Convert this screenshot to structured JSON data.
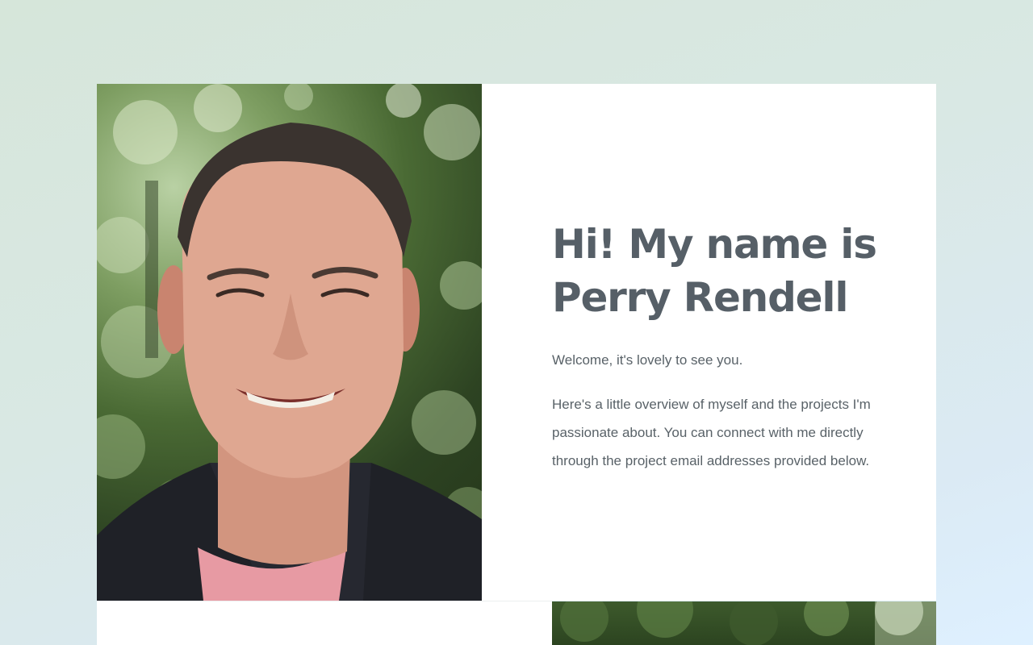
{
  "hero": {
    "title_line1": "Hi! My name is",
    "title_line2": "Perry Rendell",
    "welcome": "Welcome, it's lovely to see you.",
    "overview": "Here's a little overview of myself and the projects I'm passionate about. You can connect with me directly through the project email addresses provided below.",
    "portrait_alt": "Perry Rendell"
  },
  "colors": {
    "heading": "#565f67",
    "body_text": "#596268",
    "card_bg": "#ffffff",
    "page_bg_start": "#d6e6da",
    "page_bg_end": "#def0ff"
  }
}
